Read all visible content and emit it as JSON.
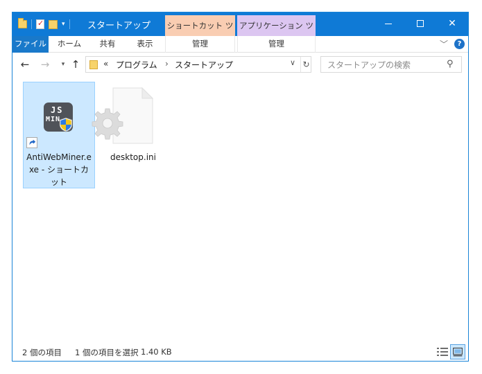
{
  "window": {
    "title": "スタートアップ",
    "contextual_tabs": [
      {
        "label": "ショートカット ツール",
        "color": "#f9cdb2"
      },
      {
        "label": "アプリケーション ツール",
        "color": "#dcc6f1"
      }
    ],
    "accent_color": "#0f7ad6"
  },
  "ribbon": {
    "file_tab": "ファイル",
    "tabs": [
      "ホーム",
      "共有",
      "表示"
    ],
    "manage_tabs": [
      "管理",
      "管理"
    ]
  },
  "navigation": {
    "address_overflow": "«",
    "breadcrumbs": [
      "プログラム",
      "スタートアップ"
    ],
    "breadcrumb_separator": "›",
    "search_placeholder": "スタートアップの検索"
  },
  "files": [
    {
      "name": "AntiWebMiner.exe - ショートカット",
      "type": "shortcut",
      "selected": true,
      "icon": "js-miner-app-icon",
      "icon_text_top": "JS",
      "icon_text_bottom": "MIN"
    },
    {
      "name": "desktop.ini",
      "type": "configuration-settings",
      "selected": false,
      "icon": "gear-document-icon"
    }
  ],
  "status": {
    "item_count": "2 個の項目",
    "selection": "1 個の項目を選択",
    "selection_size": "1.40 KB"
  }
}
